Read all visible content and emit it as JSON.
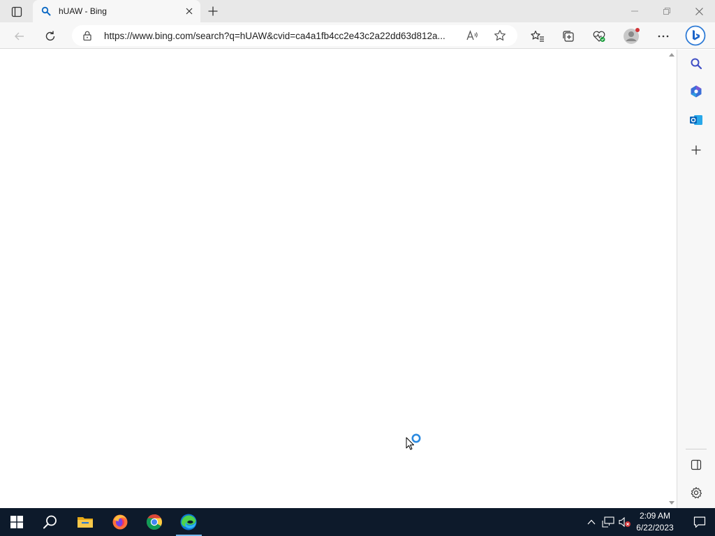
{
  "browser": {
    "tab": {
      "title": "hUAW - Bing",
      "favicon": "search-icon"
    },
    "address_bar": {
      "url": "https://www.bing.com/search?q=hUAW&cvid=ca4a1fb4cc2e43c2a22dd63d812a...",
      "read_aloud_label": "A¹⁾"
    },
    "toolbar_icons": [
      "back-icon",
      "refresh-icon",
      "lock-icon",
      "read-aloud-icon",
      "star-icon",
      "favorites-icon",
      "collections-icon",
      "browser-essentials-icon",
      "profile-avatar",
      "more-icon",
      "bing-chat-icon"
    ],
    "sidebar_icons": [
      "search-icon",
      "copilot-icon",
      "outlook-icon",
      "add-icon",
      "sidebar-toggle-icon",
      "settings-icon"
    ],
    "page_state": "loading"
  },
  "taskbar": {
    "apps": [
      "windows-start-icon",
      "search-icon",
      "file-explorer-icon",
      "firefox-icon",
      "chrome-icon",
      "edge-icon"
    ],
    "active_app": "edge-icon",
    "clock": {
      "time": "2:09 AM",
      "date": "6/22/2023"
    }
  },
  "colors": {
    "taskbar_bg": "#0d1a2b",
    "accent": "#0078d4",
    "tab_strip": "#e8e8e8",
    "toolbar": "#f7f7f7"
  }
}
